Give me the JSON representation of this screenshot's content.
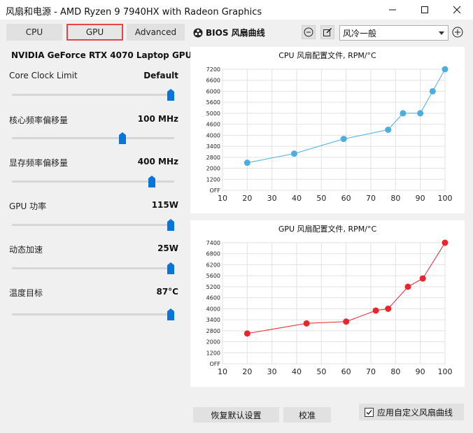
{
  "window": {
    "title": "风扇和电源 - AMD Ryzen 9 7940HX with Radeon Graphics"
  },
  "tabs": [
    {
      "label": "CPU",
      "active": false
    },
    {
      "label": "GPU",
      "active": true
    },
    {
      "label": "Advanced",
      "active": false
    }
  ],
  "gpu": {
    "name": "NVIDIA GeForce RTX 4070 Laptop GPU"
  },
  "sliders": [
    {
      "label": "Core Clock Limit",
      "value": "Default",
      "level": 1.0
    },
    {
      "label": "核心频率偏移量",
      "value": "100 MHz",
      "level": 0.69
    },
    {
      "label": "显存频率偏移量",
      "value": "400 MHz",
      "level": 0.88
    },
    {
      "label": "GPU 功率",
      "value": "115W",
      "level": 1.0
    },
    {
      "label": "动态加速",
      "value": "25W",
      "level": 1.0
    },
    {
      "label": "温度目标",
      "value": "87°C",
      "level": 1.0
    }
  ],
  "fan": {
    "bios_label": "BIOS 风扇曲线",
    "mode_value": "风冷一般",
    "mode_options": [
      "风冷一般"
    ]
  },
  "colors": {
    "cpu_series": "#4aaee0",
    "gpu_series": "#e8262c",
    "active_tab_border": "#e64545"
  },
  "chart_data": [
    {
      "type": "line",
      "title": "CPU 风扇配置文件, RPM/°C",
      "x": [
        20,
        39,
        59,
        77,
        83,
        90,
        95,
        100
      ],
      "y": [
        2400,
        3000,
        3800,
        4300,
        5000,
        5000,
        6000,
        7200
      ],
      "xlim": [
        10,
        100
      ],
      "ylim": [
        0,
        7200
      ],
      "xticks": [
        10,
        20,
        30,
        40,
        50,
        60,
        70,
        80,
        90,
        100
      ],
      "yticks": [
        "OFF",
        "1200",
        "2000",
        "2800",
        "3400",
        "4000",
        "4600",
        "5000",
        "5600",
        "6000",
        "6600",
        "7200"
      ],
      "grid": true
    },
    {
      "type": "line",
      "title": "GPU 风扇配置文件, RPM/°C",
      "x": [
        20,
        44,
        60,
        72,
        77,
        85,
        91,
        100
      ],
      "y": [
        2600,
        3200,
        3300,
        3900,
        4000,
        5200,
        5500,
        7400
      ],
      "xlim": [
        10,
        100
      ],
      "ylim": [
        0,
        7400
      ],
      "xticks": [
        10,
        20,
        30,
        40,
        50,
        60,
        70,
        80,
        90,
        100
      ],
      "yticks": [
        "OFF",
        "1200",
        "2000",
        "2800",
        "3400",
        "4000",
        "4600",
        "5200",
        "5600",
        "6200",
        "6800",
        "7400"
      ],
      "grid": true
    }
  ],
  "footer": {
    "reset_label": "恢复默认设置",
    "calibrate_label": "校准",
    "custom_curve_label": "应用自定义风扇曲线",
    "custom_curve_checked": true
  }
}
